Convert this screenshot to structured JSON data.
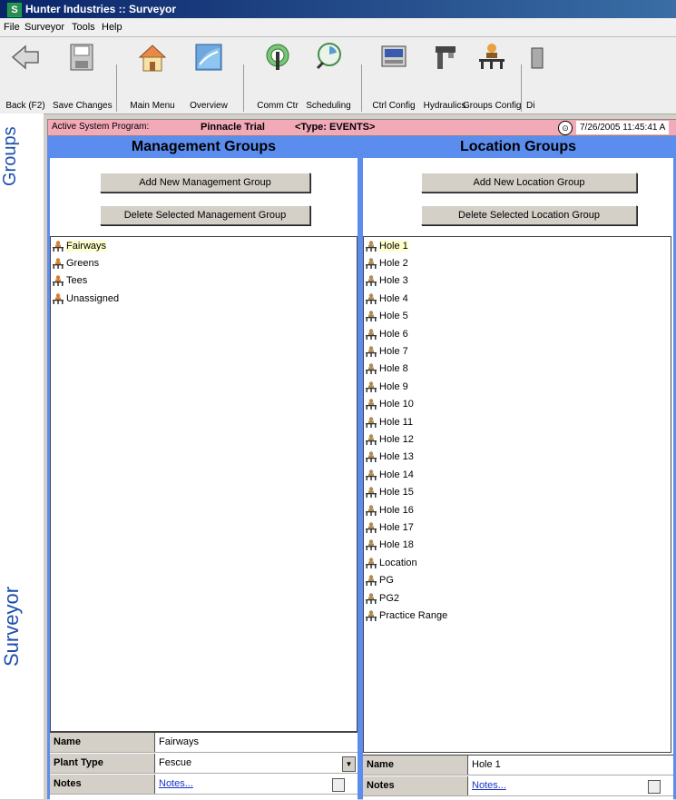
{
  "window": {
    "title": "Hunter Industries :: Surveyor"
  },
  "menu": [
    "File",
    "Surveyor",
    "Tools",
    "Help"
  ],
  "toolbar": [
    {
      "label": "Back (F2)",
      "icon": "back-arrow-icon"
    },
    {
      "label": "Save Changes",
      "icon": "floppy-disk-icon"
    },
    {
      "label": "Main Menu",
      "icon": "house-icon"
    },
    {
      "label": "Overview",
      "icon": "overview-map-icon"
    },
    {
      "label": "Comm Ctr",
      "icon": "antenna-icon"
    },
    {
      "label": "Scheduling",
      "icon": "scheduling-icon"
    },
    {
      "label": "Ctrl Config",
      "icon": "controller-icon"
    },
    {
      "label": "Hydraulics",
      "icon": "sprinkler-icon"
    },
    {
      "label": "Groups Config",
      "icon": "groups-icon"
    },
    {
      "label": "Di",
      "icon": "diagnostics-icon"
    }
  ],
  "sidebar": {
    "top_label": "Groups",
    "bottom_label": "Surveyor"
  },
  "status": {
    "label": "Active System Program:",
    "program": "Pinnacle Trial",
    "type": "<Type: EVENTS>",
    "datetime": "7/26/2005 11:45:41 A"
  },
  "management": {
    "title": "Management Groups",
    "add_button": "Add New Management Group",
    "delete_button": "Delete Selected Management Group",
    "items": [
      "Fairways",
      "Greens",
      "Tees",
      "Unassigned"
    ],
    "selected": "Fairways",
    "props": {
      "name_label": "Name",
      "name_value": "Fairways",
      "plant_label": "Plant Type",
      "plant_value": "Fescue",
      "notes_label": "Notes",
      "notes_value": "Notes..."
    }
  },
  "location": {
    "title": "Location Groups",
    "add_button": "Add New Location Group",
    "delete_button": "Delete Selected Location Group",
    "items": [
      "Hole 1",
      "Hole 2",
      "Hole 3",
      "Hole 4",
      "Hole 5",
      "Hole 6",
      "Hole 7",
      "Hole 8",
      "Hole 9",
      "Hole 10",
      "Hole 11",
      "Hole 12",
      "Hole 13",
      "Hole 14",
      "Hole 15",
      "Hole 16",
      "Hole 17",
      "Hole 18",
      "Location",
      "PG",
      "PG2",
      "Practice Range"
    ],
    "selected": "Hole 1",
    "props": {
      "name_label": "Name",
      "name_value": "Hole 1",
      "notes_label": "Notes",
      "notes_value": "Notes..."
    }
  },
  "colors": {
    "panel_blue": "#5b8def",
    "status_pink": "#f2a9b8",
    "title_blue": "#0a246a"
  }
}
